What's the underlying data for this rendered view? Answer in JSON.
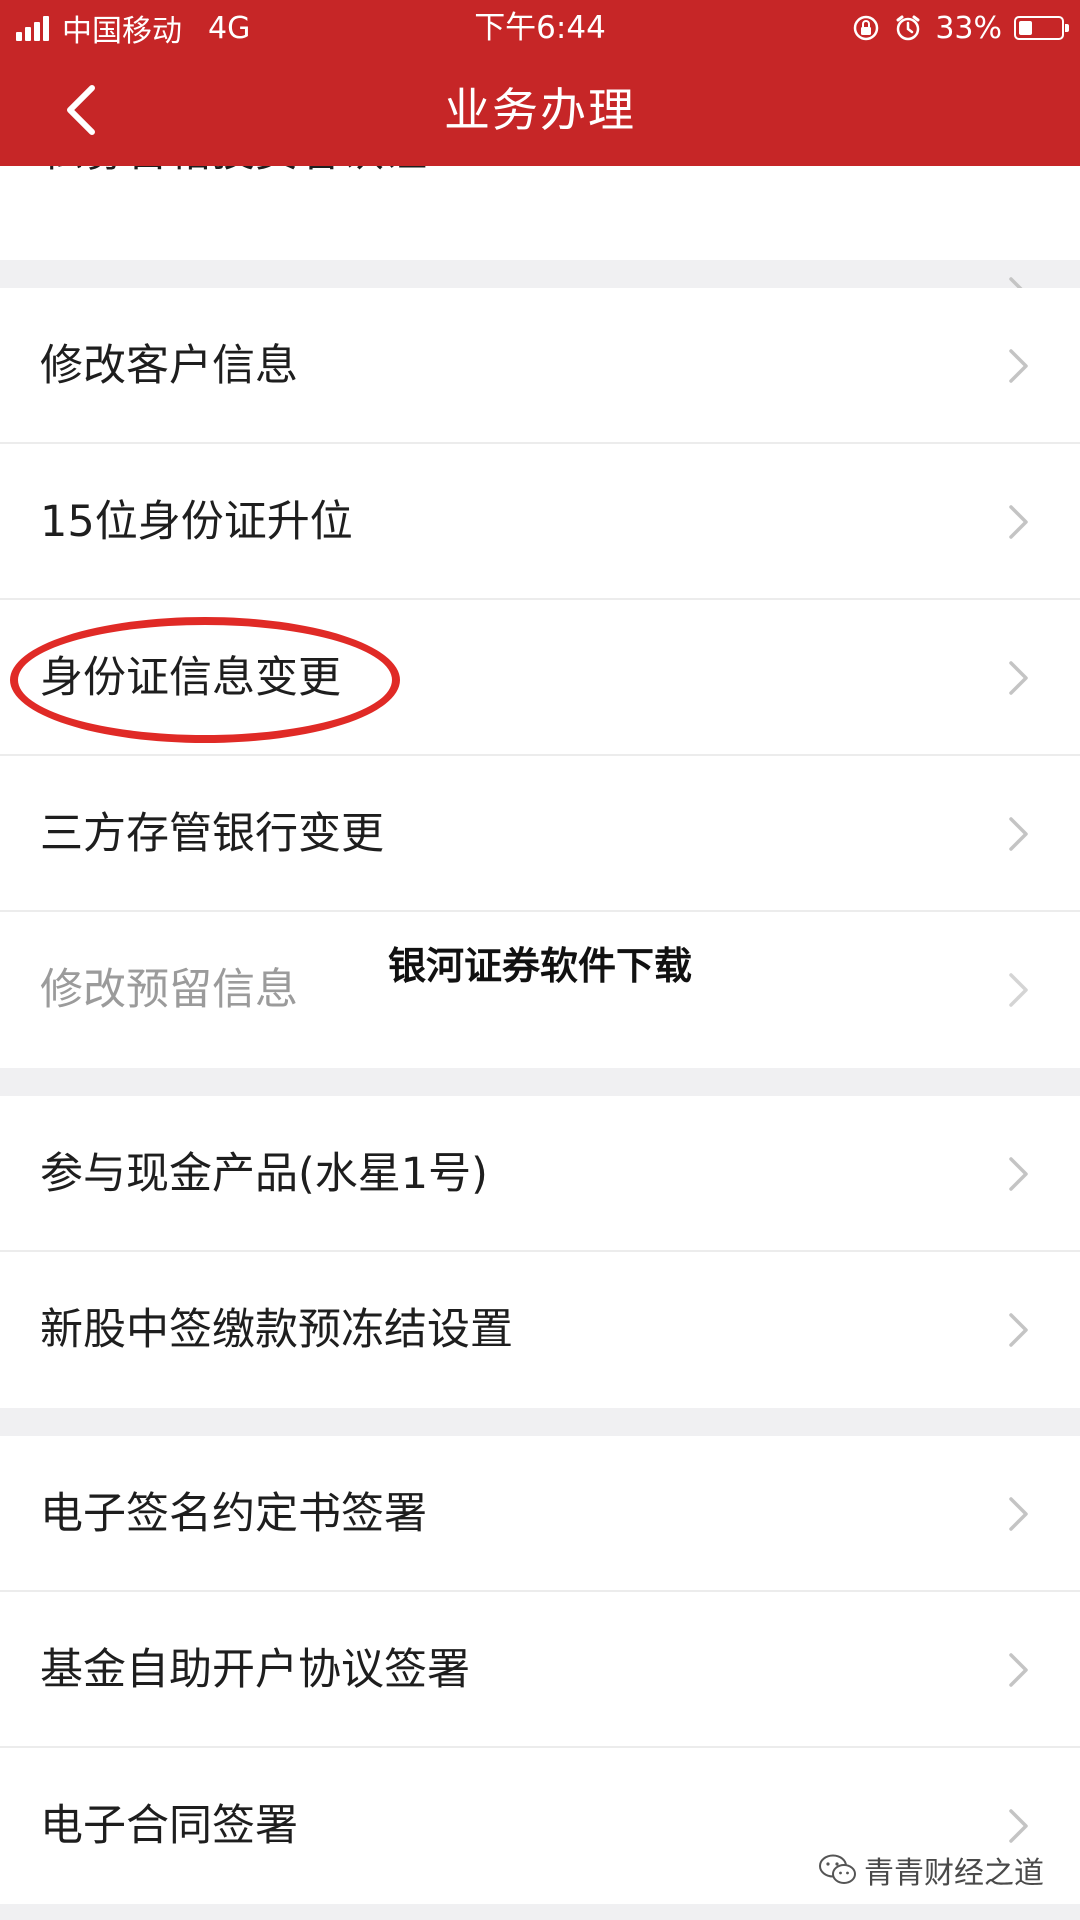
{
  "status_bar": {
    "carrier": "中国移动",
    "network": "4G",
    "time": "下午6:44",
    "battery": "33%",
    "battery_level_percent": 33
  },
  "header": {
    "title": "业务办理",
    "back_icon": "chevron-left-icon"
  },
  "menu": {
    "items": [
      {
        "label": "私募合格投资者认证"
      },
      {
        "label": "修改客户信息"
      },
      {
        "label": "15位身份证升位"
      },
      {
        "label": "身份证信息变更"
      },
      {
        "label": "三方存管银行变更"
      },
      {
        "label": "修改预留信息"
      },
      {
        "label": "参与现金产品(水星1号)"
      },
      {
        "label": "新股中签缴款预冻结设置"
      },
      {
        "label": "电子签名约定书签署"
      },
      {
        "label": "基金自助开户协议签署"
      },
      {
        "label": "电子合同签署"
      }
    ]
  },
  "overlay_text": "银河证券软件下载",
  "watermark": {
    "icon": "wechat-icon",
    "text": "青青财经之道"
  },
  "colors": {
    "header_bg": "#c62627",
    "annotation_red": "#e02a26",
    "page_bg": "#f0f0f2"
  }
}
